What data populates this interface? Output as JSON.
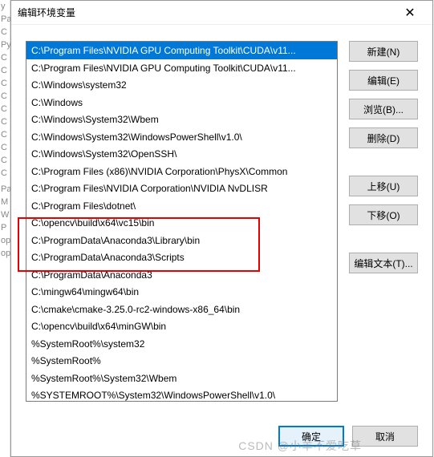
{
  "dialog": {
    "title": "编辑环境变量",
    "close": "✕"
  },
  "list": {
    "items": [
      "C:\\Program Files\\NVIDIA GPU Computing Toolkit\\CUDA\\v11...",
      "C:\\Program Files\\NVIDIA GPU Computing Toolkit\\CUDA\\v11...",
      "C:\\Windows\\system32",
      "C:\\Windows",
      "C:\\Windows\\System32\\Wbem",
      "C:\\Windows\\System32\\WindowsPowerShell\\v1.0\\",
      "C:\\Windows\\System32\\OpenSSH\\",
      "C:\\Program Files (x86)\\NVIDIA Corporation\\PhysX\\Common",
      "C:\\Program Files\\NVIDIA Corporation\\NVIDIA NvDLISR",
      "C:\\Program Files\\dotnet\\",
      "C:\\opencv\\build\\x64\\vc15\\bin",
      "C:\\ProgramData\\Anaconda3\\Library\\bin",
      "C:\\ProgramData\\Anaconda3\\Scripts",
      "C:\\ProgramData\\Anaconda3",
      "C:\\mingw64\\mingw64\\bin",
      "C:\\cmake\\cmake-3.25.0-rc2-windows-x86_64\\bin",
      "C:\\opencv\\build\\x64\\minGW\\bin",
      "%SystemRoot%\\system32",
      "%SystemRoot%",
      "%SystemRoot%\\System32\\Wbem",
      "%SYSTEMROOT%\\System32\\WindowsPowerShell\\v1.0\\"
    ],
    "selected_index": 0
  },
  "buttons": {
    "new": "新建(N)",
    "edit": "编辑(E)",
    "browse": "浏览(B)...",
    "delete": "删除(D)",
    "moveup": "上移(U)",
    "movedown": "下移(O)",
    "edittext": "编辑文本(T)..."
  },
  "footer": {
    "ok": "确定",
    "cancel": "取消"
  },
  "bgletters": [
    "y",
    "Pa",
    "C",
    "Py",
    "C",
    "C",
    "C",
    "C",
    "C",
    "C",
    "C",
    "C",
    "C",
    "C",
    "",
    "Pa",
    "M",
    "W",
    "P",
    "op",
    "op"
  ],
  "watermark": "CSDN @小羊不爱吃草"
}
